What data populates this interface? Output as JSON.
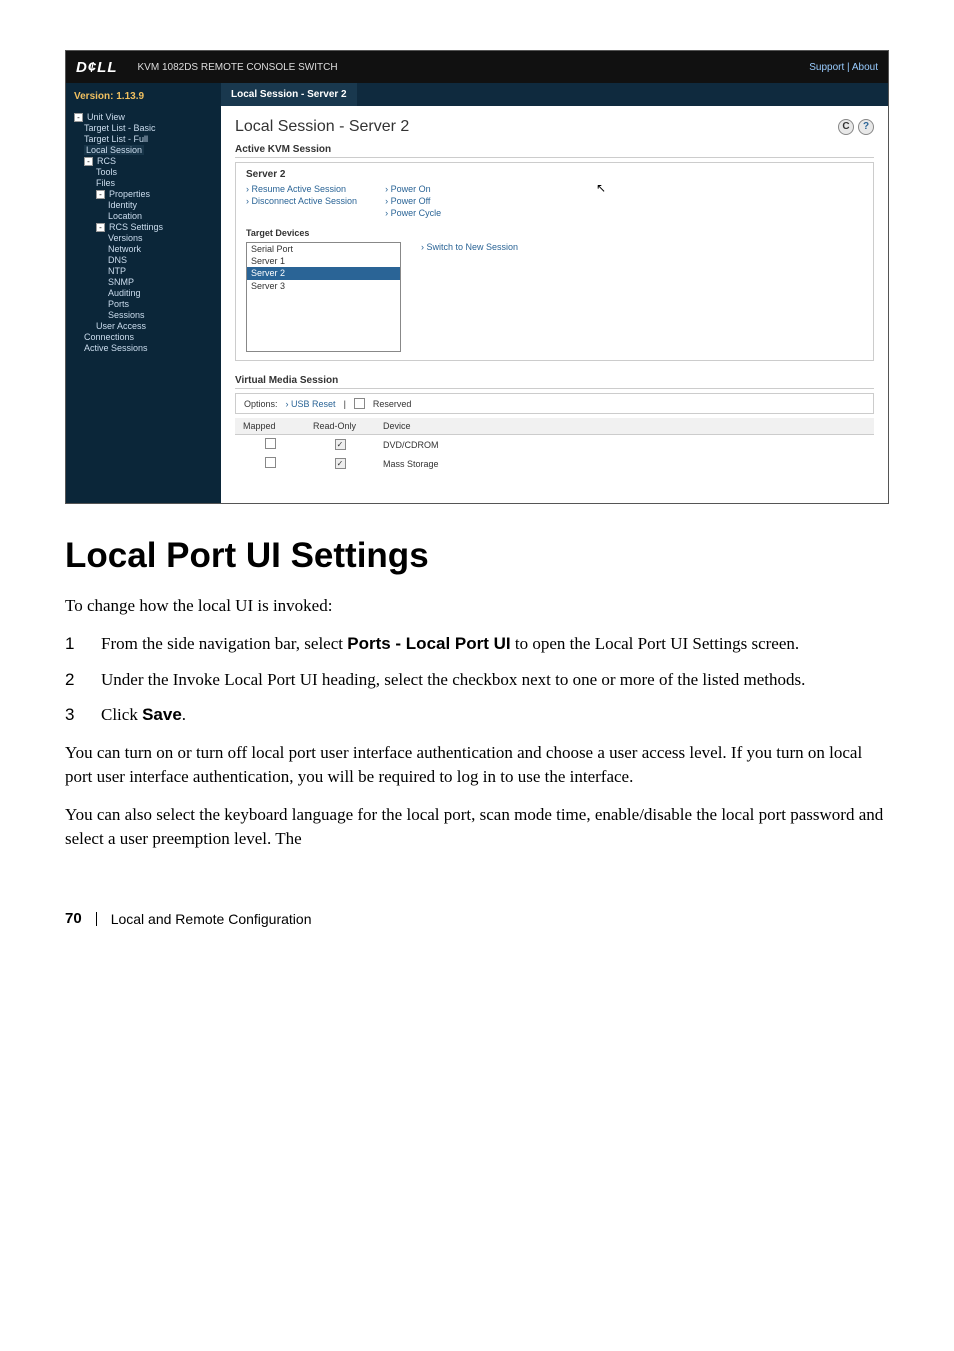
{
  "screenshot": {
    "logo": "D¢LL",
    "product": "KVM 1082DS REMOTE CONSOLE SWITCH",
    "header_links": {
      "support": "Support",
      "about": "About"
    },
    "version_label": "Version: 1.13.9",
    "tree": {
      "unit_view": "Unit View",
      "target_basic": "Target List - Basic",
      "target_full": "Target List - Full",
      "local_session": "Local Session",
      "rcs": "RCS",
      "tools": "Tools",
      "files": "Files",
      "properties": "Properties",
      "identity": "Identity",
      "location": "Location",
      "rcs_settings": "RCS Settings",
      "versions": "Versions",
      "network": "Network",
      "dns": "DNS",
      "ntp": "NTP",
      "snmp": "SNMP",
      "auditing": "Auditing",
      "ports": "Ports",
      "sessions": "Sessions",
      "user_access": "User Access",
      "connections": "Connections",
      "active_sessions": "Active Sessions"
    },
    "tab": "Local Session - Server 2",
    "page_heading": "Local Session - Server 2",
    "active_kvm": "Active KVM Session",
    "server_name": "Server 2",
    "actions": {
      "resume": "Resume Active Session",
      "disconnect": "Disconnect Active Session",
      "power_on": "Power On",
      "power_off": "Power Off",
      "power_cycle": "Power Cycle"
    },
    "target_devices_label": "Target Devices",
    "targets": [
      "Serial Port",
      "Server 1",
      "Server 2",
      "Server 3"
    ],
    "switch_link": "Switch to New Session",
    "vms_label": "Virtual Media Session",
    "vms_options": "Options:",
    "vms_usb_reset": "USB Reset",
    "vms_reserved": "Reserved",
    "vms_cols": {
      "mapped": "Mapped",
      "readonly": "Read-Only",
      "device": "Device"
    },
    "vms_rows": [
      {
        "device": "DVD/CDROM",
        "readonly_checked": true
      },
      {
        "device": "Mass Storage",
        "readonly_checked": true
      }
    ]
  },
  "doc": {
    "heading": "Local Port UI Settings",
    "intro": "To change how the local UI is invoked:",
    "step1_a": "From the side navigation bar, select ",
    "step1_b": "Ports - Local Port UI",
    "step1_c": " to open the Local Port UI Settings screen.",
    "step2": "Under the Invoke Local Port UI heading, select the checkbox next to one or more of the listed methods.",
    "step3_a": "Click ",
    "step3_b": "Save",
    "step3_c": ".",
    "para1": "You can turn on or turn off local port user interface authentication and choose a user access level. If you turn on local port user interface authentication, you will be required to log in to use the interface.",
    "para2": "You can also select the keyboard language for the local port, scan mode time, enable/disable the local port password and select a user preemption level. The",
    "page_num": "70",
    "footer_txt": "Local and Remote Configuration"
  }
}
